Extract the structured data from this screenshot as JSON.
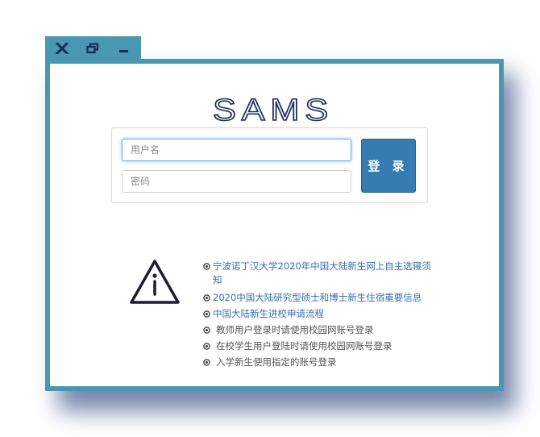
{
  "window_controls": {
    "close_icon": "close-icon",
    "restore_icon": "restore-icon",
    "minimize_icon": "minimize-icon",
    "color": "#4997b1"
  },
  "logo": {
    "text": "SAMS",
    "color": "#1f2d5c"
  },
  "login": {
    "username_placeholder": "用户名",
    "password_placeholder": "密码",
    "submit_label": "登 录",
    "button_color": "#347cb1"
  },
  "notices": [
    {
      "text": "宁波诺丁汉大学2020年中国大陆新生网上自主选寝须知",
      "link": true
    },
    {
      "text": "2020中国大陆研究型硕士和博士新生住宿重要信息",
      "link": true
    },
    {
      "text": "中国大陆新生进校申请流程",
      "link": true
    },
    {
      "text": "教师用户登录时请使用校园网账号登录",
      "link": false
    },
    {
      "text": "在校学生用户登陆时请使用校园网账号登录",
      "link": false
    },
    {
      "text": "入学新生使用指定的账号登录",
      "link": false
    }
  ],
  "colors": {
    "link": "#3a6fb0",
    "text": "#555555",
    "frame": "#4997b1"
  }
}
